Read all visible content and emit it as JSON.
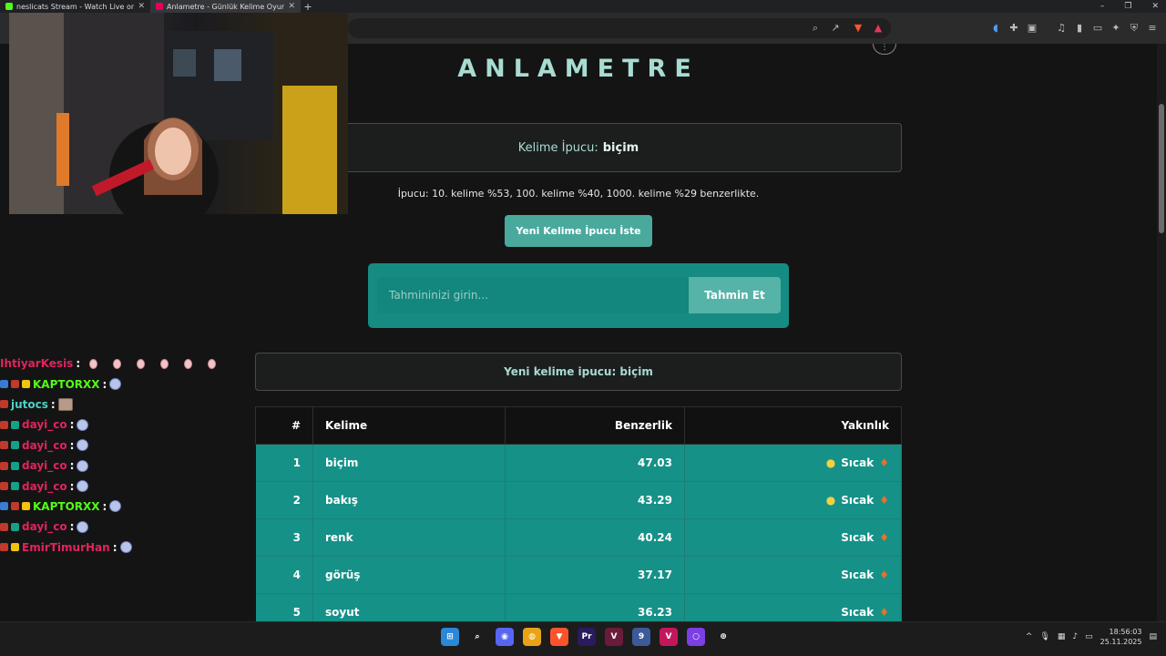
{
  "browser": {
    "tabs": [
      {
        "title": "neslicats Stream - Watch Live on Kick",
        "favicon_color": "#53fc18",
        "active": false
      },
      {
        "title": "Anlametre - Günlük Kelime Oyunu",
        "favicon_color": "#e6005c",
        "active": true
      }
    ],
    "new_tab_label": "+",
    "window_controls": [
      "–",
      "❐",
      "✕"
    ]
  },
  "page": {
    "logo": "ANLAMETRE",
    "hint_card": {
      "label": "Kelime İpucu:",
      "word": "biçim"
    },
    "hint_info": "İpucu: 10. kelime %53, 100. kelime %40, 1000. kelime %29 benzerlikte.",
    "new_hint_button": "Yeni Kelime İpucu İste",
    "guess": {
      "placeholder": "Tahmininizi girin...",
      "button": "Tahmin Et"
    },
    "status_message": "Yeni kelime ipucu: biçim",
    "table": {
      "headers": [
        "#",
        "Kelime",
        "Benzerlik",
        "Yakınlık"
      ],
      "rows": [
        {
          "rank": "1",
          "word": "biçim",
          "similarity": "47.03",
          "proximity": "Sıcak",
          "bulb": true
        },
        {
          "rank": "2",
          "word": "bakış",
          "similarity": "43.29",
          "proximity": "Sıcak",
          "bulb": true
        },
        {
          "rank": "3",
          "word": "renk",
          "similarity": "40.24",
          "proximity": "Sıcak",
          "bulb": false
        },
        {
          "rank": "4",
          "word": "görüş",
          "similarity": "37.17",
          "proximity": "Sıcak",
          "bulb": false
        },
        {
          "rank": "5",
          "word": "soyut",
          "similarity": "36.23",
          "proximity": "Sıcak",
          "bulb": false
        }
      ]
    }
  },
  "chat": [
    {
      "user": "IhtiyarKesis",
      "color": "#e0245e",
      "badges": [],
      "emotes": [
        "pink",
        "pink",
        "pink",
        "pink",
        "pink",
        "pink"
      ]
    },
    {
      "user": "KAPTORXX",
      "color": "#53fc18",
      "badges": [
        "#3a7bd5",
        "#c0392b",
        "#f1c40f"
      ],
      "emotes": [
        "ghost"
      ]
    },
    {
      "user": "jutocs",
      "color": "#4fd1c5",
      "badges": [
        "#c0392b"
      ],
      "emotes": [
        "img"
      ]
    },
    {
      "user": "dayi_co",
      "color": "#e0245e",
      "badges": [
        "#c0392b",
        "#16a085"
      ],
      "emotes": [
        "ghost"
      ]
    },
    {
      "user": "dayi_co",
      "color": "#e0245e",
      "badges": [
        "#c0392b",
        "#16a085"
      ],
      "emotes": [
        "ghost"
      ]
    },
    {
      "user": "dayi_co",
      "color": "#e0245e",
      "badges": [
        "#c0392b",
        "#16a085"
      ],
      "emotes": [
        "ghost"
      ]
    },
    {
      "user": "dayi_co",
      "color": "#e0245e",
      "badges": [
        "#c0392b",
        "#16a085"
      ],
      "emotes": [
        "ghost"
      ]
    },
    {
      "user": "KAPTORXX",
      "color": "#53fc18",
      "badges": [
        "#3a7bd5",
        "#c0392b",
        "#f1c40f"
      ],
      "emotes": [
        "ghost"
      ]
    },
    {
      "user": "dayi_co",
      "color": "#e0245e",
      "badges": [
        "#c0392b",
        "#16a085"
      ],
      "emotes": [
        "ghost"
      ]
    },
    {
      "user": "EmirTimurHan",
      "color": "#e0245e",
      "badges": [
        "#c0392b",
        "#f1c40f"
      ],
      "emotes": [
        "ghost"
      ]
    }
  ],
  "taskbar": {
    "apps": [
      {
        "name": "windows-start",
        "color": "#2b88d8",
        "glyph": "⊞"
      },
      {
        "name": "search",
        "color": "transparent",
        "glyph": "⌕"
      },
      {
        "name": "discord",
        "color": "#5865f2",
        "glyph": "◉"
      },
      {
        "name": "chrome",
        "color": "#e8a317",
        "glyph": "◍"
      },
      {
        "name": "brave",
        "color": "#fb542b",
        "glyph": "▼"
      },
      {
        "name": "premiere",
        "color": "#2a1a5e",
        "glyph": "Pr"
      },
      {
        "name": "vegas",
        "color": "#6a1b3a",
        "glyph": "V"
      },
      {
        "name": "app-blue",
        "color": "#3c5a99",
        "glyph": "9"
      },
      {
        "name": "app-red",
        "color": "#c2185b",
        "glyph": "V"
      },
      {
        "name": "app-purple",
        "color": "#7b3fe4",
        "glyph": "○"
      },
      {
        "name": "app-globe",
        "color": "transparent",
        "glyph": "⊕"
      }
    ],
    "clock_time": "18:56:03",
    "clock_date": "25.11.2025"
  }
}
